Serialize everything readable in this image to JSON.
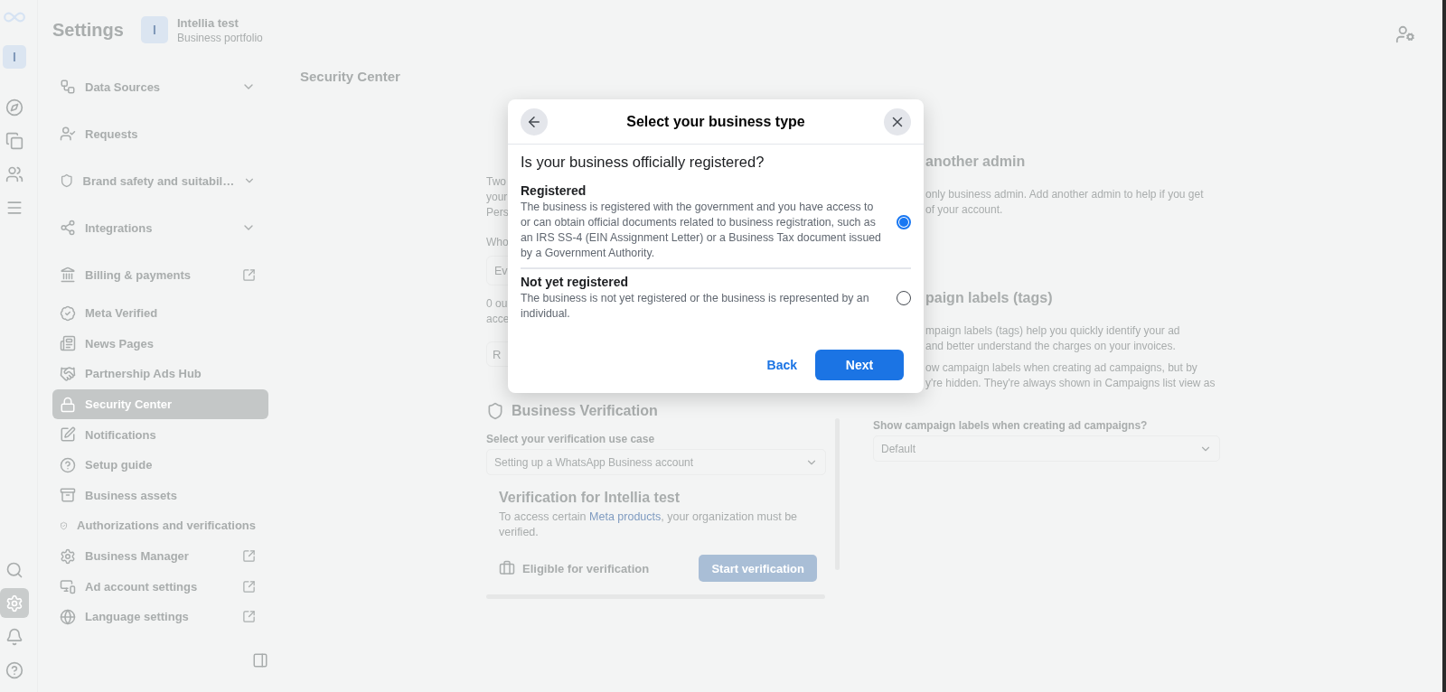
{
  "rail": {
    "account_initial": "I",
    "top_items": [
      {
        "selected": false
      },
      {
        "selected": false
      },
      {
        "selected": false
      },
      {
        "selected": false
      }
    ],
    "bottom_items": [
      {
        "selected": false
      },
      {
        "selected": true
      },
      {
        "selected": false
      },
      {
        "selected": false
      }
    ]
  },
  "sidebar": {
    "title": "Settings",
    "business": {
      "initial": "I",
      "name": "Intellia test",
      "subtitle": "Business portfolio"
    },
    "items": [
      {
        "label": "Data Sources",
        "kind": "section",
        "expandable": true,
        "external": false,
        "selected": false
      },
      {
        "label": "Requests",
        "kind": "section",
        "expandable": false,
        "external": false,
        "selected": false
      },
      {
        "label": "Brand safety and suitabil…",
        "kind": "section",
        "expandable": true,
        "external": false,
        "selected": false
      },
      {
        "label": "Integrations",
        "kind": "section",
        "expandable": true,
        "external": false,
        "selected": false
      },
      {
        "label": "Billing & payments",
        "kind": "section",
        "expandable": false,
        "external": true,
        "selected": false
      },
      {
        "label": "Meta Verified",
        "kind": "item",
        "expandable": false,
        "external": false,
        "selected": false
      },
      {
        "label": "News Pages",
        "kind": "item",
        "expandable": false,
        "external": false,
        "selected": false
      },
      {
        "label": "Partnership Ads Hub",
        "kind": "item",
        "expandable": false,
        "external": false,
        "selected": false
      },
      {
        "label": "Security Center",
        "kind": "item",
        "expandable": false,
        "external": false,
        "selected": true
      },
      {
        "label": "Notifications",
        "kind": "item",
        "expandable": false,
        "external": false,
        "selected": false
      },
      {
        "label": "Setup guide",
        "kind": "item",
        "expandable": false,
        "external": false,
        "selected": false
      },
      {
        "label": "Business assets",
        "kind": "item",
        "expandable": false,
        "external": false,
        "selected": false
      },
      {
        "label": "Authorizations and verifications",
        "kind": "item",
        "expandable": false,
        "external": false,
        "selected": false
      },
      {
        "label": "Business Manager",
        "kind": "item",
        "expandable": false,
        "external": true,
        "selected": false
      },
      {
        "label": "Ad account settings",
        "kind": "item",
        "expandable": false,
        "external": true,
        "selected": false
      },
      {
        "label": "Language settings",
        "kind": "item",
        "expandable": false,
        "external": true,
        "selected": false
      }
    ]
  },
  "page": {
    "title": "Security Center",
    "left_fragments": {
      "lines_1": [
        "Two",
        "your",
        "Pers"
      ],
      "label": "Who",
      "field_value": "Ev",
      "lines_2": [
        "0 ou",
        "acce"
      ],
      "button": "R"
    },
    "verification": {
      "heading": "Business Verification",
      "select_label": "Select your verification use case",
      "select_value": "Setting up a WhatsApp Business account",
      "card_title": "Verification for Intellia test",
      "text_before": "To access certain ",
      "link": "Meta products",
      "text_after": ", your organization must be verified.",
      "status": "Eligible for verification",
      "button": "Start verification"
    },
    "admin": {
      "heading": "another admin",
      "lines": [
        "only business admin. Add another admin to help if you get",
        "of your account."
      ]
    },
    "labels": {
      "heading": "paign labels (tags)",
      "paragraph_1": [
        "mpaign labels (tags) help you quickly identify your ad",
        "and better understand the charges on your invoices."
      ],
      "paragraph_2": [
        "ow campaign labels when creating ad campaigns, but by",
        "y're hidden. They're always shown in Campaigns list view as"
      ],
      "select_label": "Show campaign labels when creating ad campaigns?",
      "select_value": "Default"
    }
  },
  "dialog": {
    "title": "Select your business type",
    "question": "Is your business officially registered?",
    "options": [
      {
        "title": "Registered",
        "description": "The business is registered with the government and you have access to or can obtain official documents related to business registration, such as an IRS SS-4 (EIN Assignment Letter) or a Business Tax document issued by a Government Authority.",
        "selected": true
      },
      {
        "title": "Not yet registered",
        "description": "The business is not yet registered or the business is represented by an individual.",
        "selected": false
      }
    ],
    "back": "Back",
    "next": "Next"
  }
}
